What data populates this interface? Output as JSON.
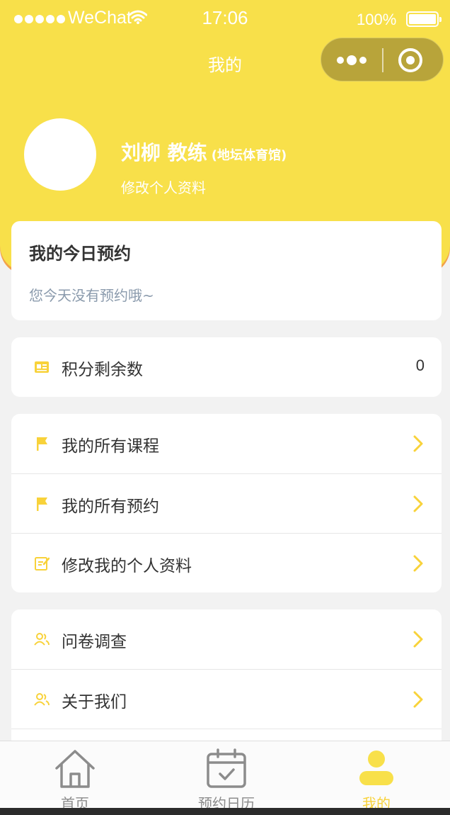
{
  "status_bar": {
    "carrier": "WeChat",
    "time": "17:06",
    "battery": "100%"
  },
  "nav": {
    "title": "我的"
  },
  "profile": {
    "name": "刘柳 教练",
    "gym": "(地坛体育馆)",
    "edit_link": "修改个人资料"
  },
  "today": {
    "title": "我的今日预约",
    "empty_text": "您今天没有预约哦~"
  },
  "points": {
    "label": "积分剩余数",
    "value": "0"
  },
  "menu_group_1": [
    {
      "label": "我的所有课程",
      "icon": "flag-icon"
    },
    {
      "label": "我的所有预约",
      "icon": "flag-icon"
    },
    {
      "label": "修改我的个人资料",
      "icon": "edit-icon"
    }
  ],
  "menu_group_2": [
    {
      "label": "问卷调查",
      "icon": "users-icon"
    },
    {
      "label": "关于我们",
      "icon": "users-icon"
    }
  ],
  "tab_bar": {
    "home": "首页",
    "calendar": "预约日历",
    "me": "我的"
  },
  "colors": {
    "brand_yellow": "#f8e04a",
    "accent_orange": "#f2a24a",
    "capsule": "#b8a43a",
    "active_tab": "#f8d23a",
    "muted_text": "#8a9aac"
  }
}
